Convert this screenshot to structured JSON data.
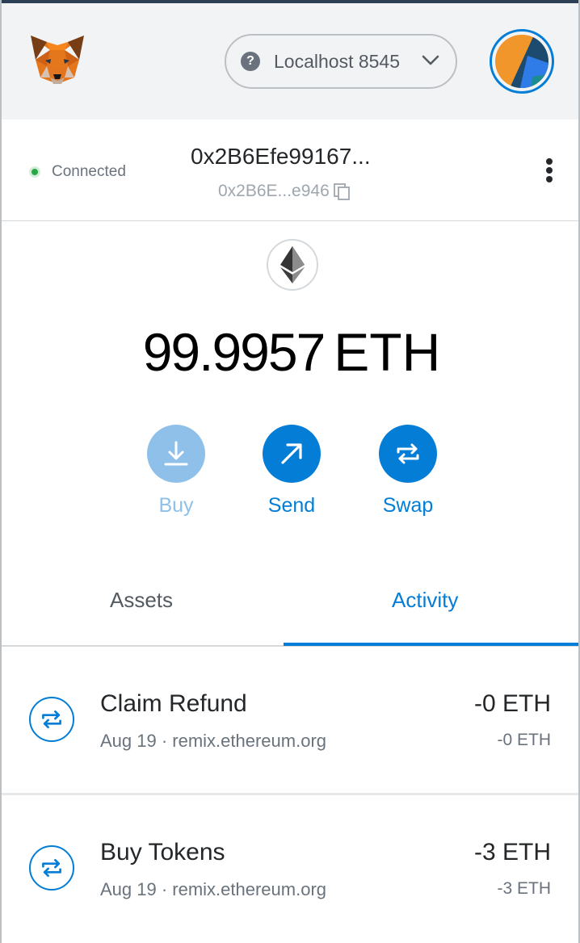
{
  "header": {
    "network_label": "Localhost 8545",
    "network_icon": "question-icon",
    "network_help_glyph": "?"
  },
  "account": {
    "connection_status": "Connected",
    "name": "0x2B6Efe99167...",
    "short_address": "0x2B6E...e946"
  },
  "balance": {
    "amount": "99.9957",
    "unit": "ETH"
  },
  "actions": [
    {
      "label": "Buy"
    },
    {
      "label": "Send"
    },
    {
      "label": "Swap"
    }
  ],
  "tabs": {
    "assets": "Assets",
    "activity": "Activity",
    "active": "Activity"
  },
  "transactions": [
    {
      "title": "Claim Refund",
      "subtitle": "Aug 19 · remix.ethereum.org",
      "amount": "-0 ETH",
      "secondary_amount": "-0 ETH"
    },
    {
      "title": "Buy Tokens",
      "subtitle": "Aug 19 · remix.ethereum.org",
      "amount": "-3 ETH",
      "secondary_amount": "-3 ETH"
    }
  ],
  "colors": {
    "accent": "#037dd6",
    "buy_disabled": "#8fc0ea",
    "connected": "#28a745",
    "header_bg": "#f2f3f4"
  }
}
